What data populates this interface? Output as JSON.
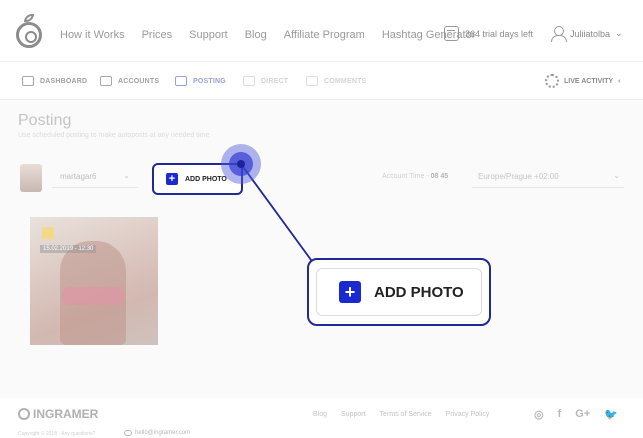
{
  "nav": {
    "links": [
      "How it Works",
      "Prices",
      "Support",
      "Blog",
      "Affiliate Program",
      "Hashtag Generator"
    ],
    "trial": "364 trial days left",
    "user": "Juliiatolba",
    "user_chevron": "⌄"
  },
  "subnav": {
    "tabs": [
      "DASHBOARD",
      "ACCOUNTS",
      "POSTING",
      "DIRECT",
      "COMMENTS"
    ],
    "live": "LIVE ACTIVITY",
    "live_chevron": "‹"
  },
  "posting": {
    "title": "Posting",
    "subtitle": "Use scheduled posting to make autoposts at any needed time"
  },
  "account": {
    "name": "martagar6",
    "chevron": "⌄",
    "time_label": "Account Time - ",
    "time_value": "08 45",
    "timezone": "Europe/Prague +02:00"
  },
  "add_photo": {
    "label": "ADD PHOTO",
    "plus": "+"
  },
  "photo": {
    "date": "15.02.2019 - 12:30"
  },
  "footer": {
    "brand": "INGRAMER",
    "links": [
      "Blog",
      "Support",
      "Terms of Service",
      "Privacy Policy"
    ],
    "social": [
      "◎",
      "f",
      "G+",
      "🐦"
    ],
    "copyright": "Copyright © 2018 · Any questions?",
    "email": "hello@ingramer.com"
  },
  "colors": {
    "accent": "#1a2ad0",
    "highlight_border": "#1f2a94",
    "active_tab": "#9aa0d8"
  }
}
